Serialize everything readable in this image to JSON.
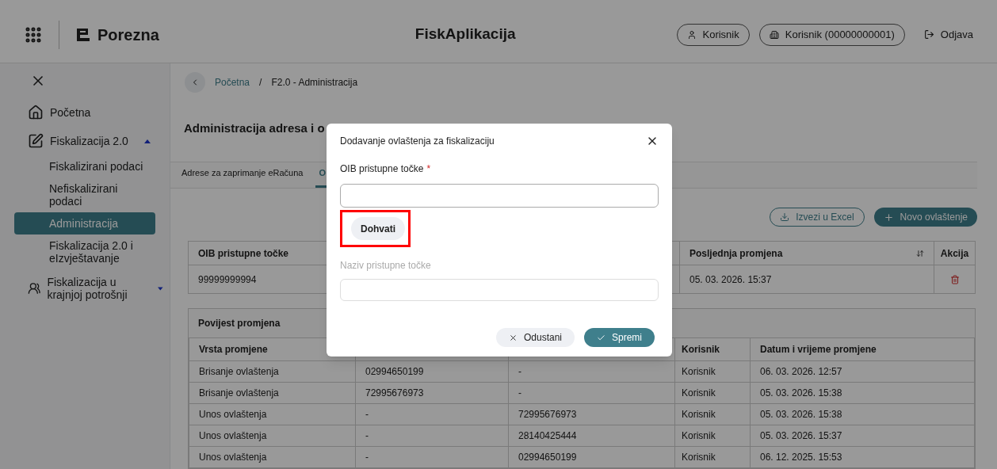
{
  "header": {
    "logo": "Porezna",
    "app_title": "FiskAplikacija",
    "user_button": "Korisnik",
    "company_button": "Korisnik (00000000001)",
    "logout": "Odjava"
  },
  "sidebar": {
    "items": [
      {
        "label": "Početna",
        "kind": "home",
        "selected": false
      },
      {
        "label": "Fiskalizacija 2.0",
        "kind": "edit",
        "expanded": true,
        "selected": false,
        "children": [
          {
            "label": "Fiskalizirani podaci",
            "selected": false
          },
          {
            "label": "Nefiskalizirani podaci",
            "selected": false
          },
          {
            "label": "Administracija",
            "selected": true
          },
          {
            "label": "Fiskalizacija 2.0 i eIzvještavanje",
            "selected": false
          }
        ]
      },
      {
        "label": "Fiskalizacija u krajnjoj potrošnji",
        "kind": "users",
        "expanded": false,
        "selected": false
      }
    ]
  },
  "breadcrumb": {
    "link": "Početna",
    "separator": "/",
    "current": "F2.0 - Administracija"
  },
  "page_title": "Administracija adresa i o",
  "tabs": [
    {
      "label": "Adrese za zaprimanje eRačuna",
      "selected": false
    },
    {
      "label": "O",
      "selected": true
    }
  ],
  "actions": {
    "export": "Izvezi u Excel",
    "add": "Novo ovlaštenje"
  },
  "auth_table": {
    "columns": [
      "OIB pristupne točke",
      "Posljednja promjena",
      "Akcija"
    ],
    "rows": [
      {
        "oib": "99999999994",
        "changed": "05. 03. 2026. 15:37"
      }
    ]
  },
  "history": {
    "title": "Povijest promjena",
    "columns": [
      "Vrsta promjene",
      "",
      "",
      "Korisnik",
      "Datum i vrijeme promjene"
    ],
    "rows": [
      [
        "Brisanje ovlaštenja",
        "02994650199",
        "-",
        "Korisnik",
        "06. 03. 2026. 12:57"
      ],
      [
        "Brisanje ovlaštenja",
        "72995676973",
        "-",
        "Korisnik",
        "05. 03. 2026. 15:38"
      ],
      [
        "Unos ovlaštenja",
        "-",
        "72995676973",
        "Korisnik",
        "05. 03. 2026. 15:38"
      ],
      [
        "Unos ovlaštenja",
        "-",
        "28140425444",
        "Korisnik",
        "05. 03. 2026. 15:37"
      ],
      [
        "Unos ovlaštenja",
        "-",
        "02994650199",
        "Korisnik",
        "06. 12. 2025. 15:53"
      ]
    ]
  },
  "dialog": {
    "title": "Dodavanje ovlaštenja za fiskalizaciju",
    "oib_label": "OIB pristupne točke",
    "required_mark": "*",
    "fetch_button": "Dohvati",
    "fetch_highlighted": true,
    "name_label": "Naziv pristupne točke",
    "cancel": "Odustani",
    "save": "Spremi"
  }
}
